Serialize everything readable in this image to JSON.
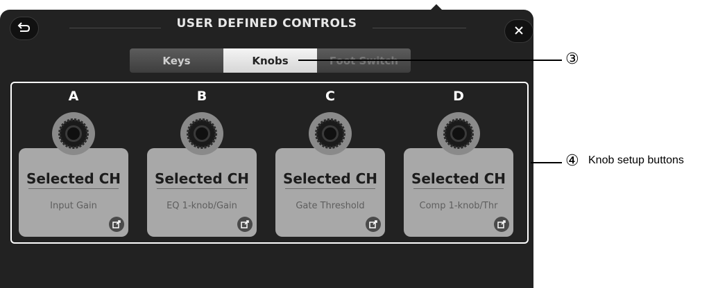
{
  "header": {
    "title": "USER DEFINED CONTROLS"
  },
  "tabs": [
    "Keys",
    "Knobs",
    "Foot Switch"
  ],
  "knobs": [
    {
      "letter": "A",
      "channel": "Selected CH",
      "parameter": "Input Gain"
    },
    {
      "letter": "B",
      "channel": "Selected CH",
      "parameter": "EQ 1-knob/Gain"
    },
    {
      "letter": "C",
      "channel": "Selected CH",
      "parameter": "Gate Threshold"
    },
    {
      "letter": "D",
      "channel": "Selected CH",
      "parameter": "Comp 1-knob/Thr"
    }
  ],
  "callouts": [
    {
      "number": "③",
      "label": ""
    },
    {
      "number": "④",
      "label": "Knob setup buttons"
    }
  ],
  "icons": {
    "back": "back-arrow-icon",
    "close": "close-icon",
    "edit": "external-edit-icon"
  }
}
